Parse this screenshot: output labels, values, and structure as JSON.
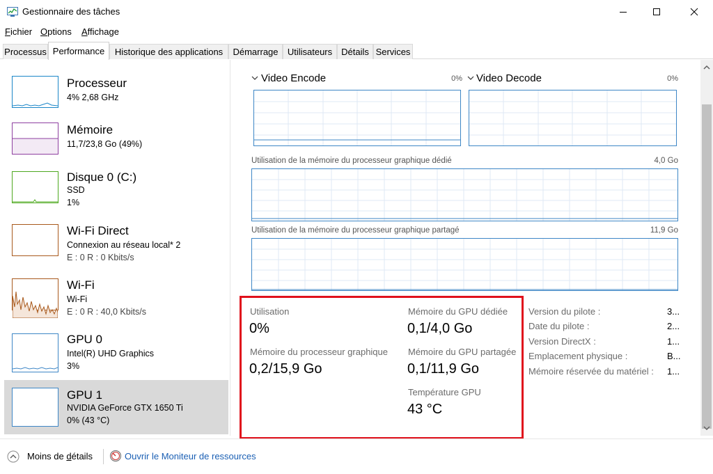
{
  "window": {
    "title": "Gestionnaire des tâches"
  },
  "menu": [
    {
      "label": "Fichier",
      "key": "F",
      "rest": "ichier"
    },
    {
      "label": "Options",
      "key": "O",
      "rest": "ptions"
    },
    {
      "label": "Affichage",
      "key": "A",
      "rest": "ffichage"
    }
  ],
  "tabs": [
    "Processus",
    "Performance",
    "Historique des applications",
    "Démarrage",
    "Utilisateurs",
    "Détails",
    "Services"
  ],
  "active_tab": "Performance",
  "sidebar": [
    {
      "title": "Processeur",
      "line1": "4%  2,68 GHz",
      "line2": "",
      "line3": ""
    },
    {
      "title": "Mémoire",
      "line1": "11,7/23,8 Go (49%)",
      "line2": "",
      "line3": ""
    },
    {
      "title": "Disque 0 (C:)",
      "line1": "SSD",
      "line2": "1%",
      "line3": ""
    },
    {
      "title": "Wi-Fi Direct",
      "line1": "Connexion au réseau local* 2",
      "line2": "E : 0 R : 0 Kbits/s",
      "line3": ""
    },
    {
      "title": "Wi-Fi",
      "line1": "Wi-Fi",
      "line2": "E : 0 R : 40,0 Kbits/s",
      "line3": ""
    },
    {
      "title": "GPU 0",
      "line1": "Intel(R) UHD Graphics",
      "line2": "3%",
      "line3": ""
    },
    {
      "title": "GPU 1",
      "line1": "NVIDIA GeForce GTX 1650 Ti",
      "line2": "0%  (43 °C)",
      "line3": ""
    }
  ],
  "colors": {
    "cpu": "#1a86c8",
    "memory": "#8e3fa0",
    "disk": "#4da81e",
    "wifi": "#a8581b",
    "gpu": "#3d86c6",
    "highlight": "#e0101b",
    "selected": "#d9d9d9"
  },
  "main": {
    "video_encode": {
      "title": "Video Encode",
      "pct": "0%"
    },
    "video_decode": {
      "title": "Video Decode",
      "pct": "0%"
    },
    "dedicated_mem": {
      "label": "Utilisation de la mémoire du processeur graphique dédié",
      "max": "4,0 Go"
    },
    "shared_mem": {
      "label": "Utilisation de la mémoire du processeur graphique partagé",
      "max": "11,9 Go"
    }
  },
  "stats": {
    "usage_label": "Utilisation",
    "usage_value": "0%",
    "dedicated_label": "Mémoire du GPU dédiée",
    "dedicated_value": "0,1/4,0 Go",
    "gpu_mem_label": "Mémoire du processeur graphique",
    "gpu_mem_value": "0,2/15,9 Go",
    "shared_label": "Mémoire du GPU partagée",
    "shared_value": "0,1/11,9 Go",
    "temp_label": "Température GPU",
    "temp_value": "43 °C"
  },
  "info": [
    {
      "label": "Version du pilote :",
      "value": "3..."
    },
    {
      "label": "Date du pilote :",
      "value": "2..."
    },
    {
      "label": "Version DirectX :",
      "value": "1..."
    },
    {
      "label": "Emplacement physique :",
      "value": "B..."
    },
    {
      "label": "Mémoire réservée du matériel :",
      "value": "1..."
    }
  ],
  "footer": {
    "fewer_prefix": "Moins de ",
    "fewer_key": "d",
    "fewer_rest": "étails",
    "monitor_link": "Ouvrir le Moniteur de ressources"
  }
}
